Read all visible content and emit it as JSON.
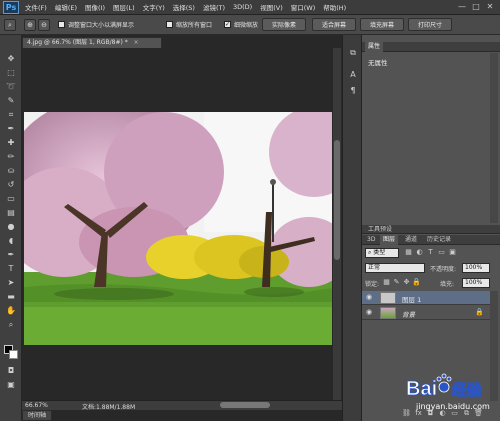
{
  "app": {
    "logo": "Ps"
  },
  "menu": [
    "文件(F)",
    "编辑(E)",
    "图像(I)",
    "图层(L)",
    "文字(Y)",
    "选择(S)",
    "滤镜(T)",
    "3D(D)",
    "视图(V)",
    "窗口(W)",
    "帮助(H)"
  ],
  "window_controls": [
    "—",
    "□",
    "✕"
  ],
  "options": {
    "tool_icon": "zoom-icon",
    "resize_windows_label": "调整窗口大小以满屏显示",
    "resize_windows_checked": false,
    "zoom_all_label": "缩放所有窗口",
    "zoom_all_checked": false,
    "scrubby_label": "细微缩放",
    "scrubby_checked": true,
    "actual_pixels": "实际像素",
    "fit_screen": "适合屏幕",
    "fill_screen": "填充屏幕",
    "print_size": "打印尺寸"
  },
  "document": {
    "tab_title": "4.jpg @ 66.7% (图层 1, RGB/8#) *",
    "close": "×",
    "zoom": "66.67%",
    "doc_info": "文档:1.88M/1.88M"
  },
  "bottom_tab": "时间轴",
  "properties_panel": {
    "title": "属性",
    "content": "无属性"
  },
  "layers_panel": {
    "group_tab": "工具预设",
    "tabs": [
      "3D",
      "图层",
      "通道",
      "历史记录"
    ],
    "filter_kind": "类型",
    "blend_mode": "正常",
    "opacity_label": "不透明度:",
    "opacity_value": "100%",
    "lock_label": "锁定:",
    "fill_label": "填充:",
    "fill_value": "100%",
    "layers": [
      {
        "name": "图层 1",
        "visible": true,
        "selected": true,
        "locked": false
      },
      {
        "name": "背景",
        "visible": true,
        "selected": false,
        "locked": true
      }
    ]
  },
  "watermark": {
    "brand": "Bai",
    "brand2": "经验",
    "url": "jingyan.baidu.com"
  },
  "colors": {
    "accent": "#4fb0ff",
    "selected_layer": "#5d6e86"
  }
}
